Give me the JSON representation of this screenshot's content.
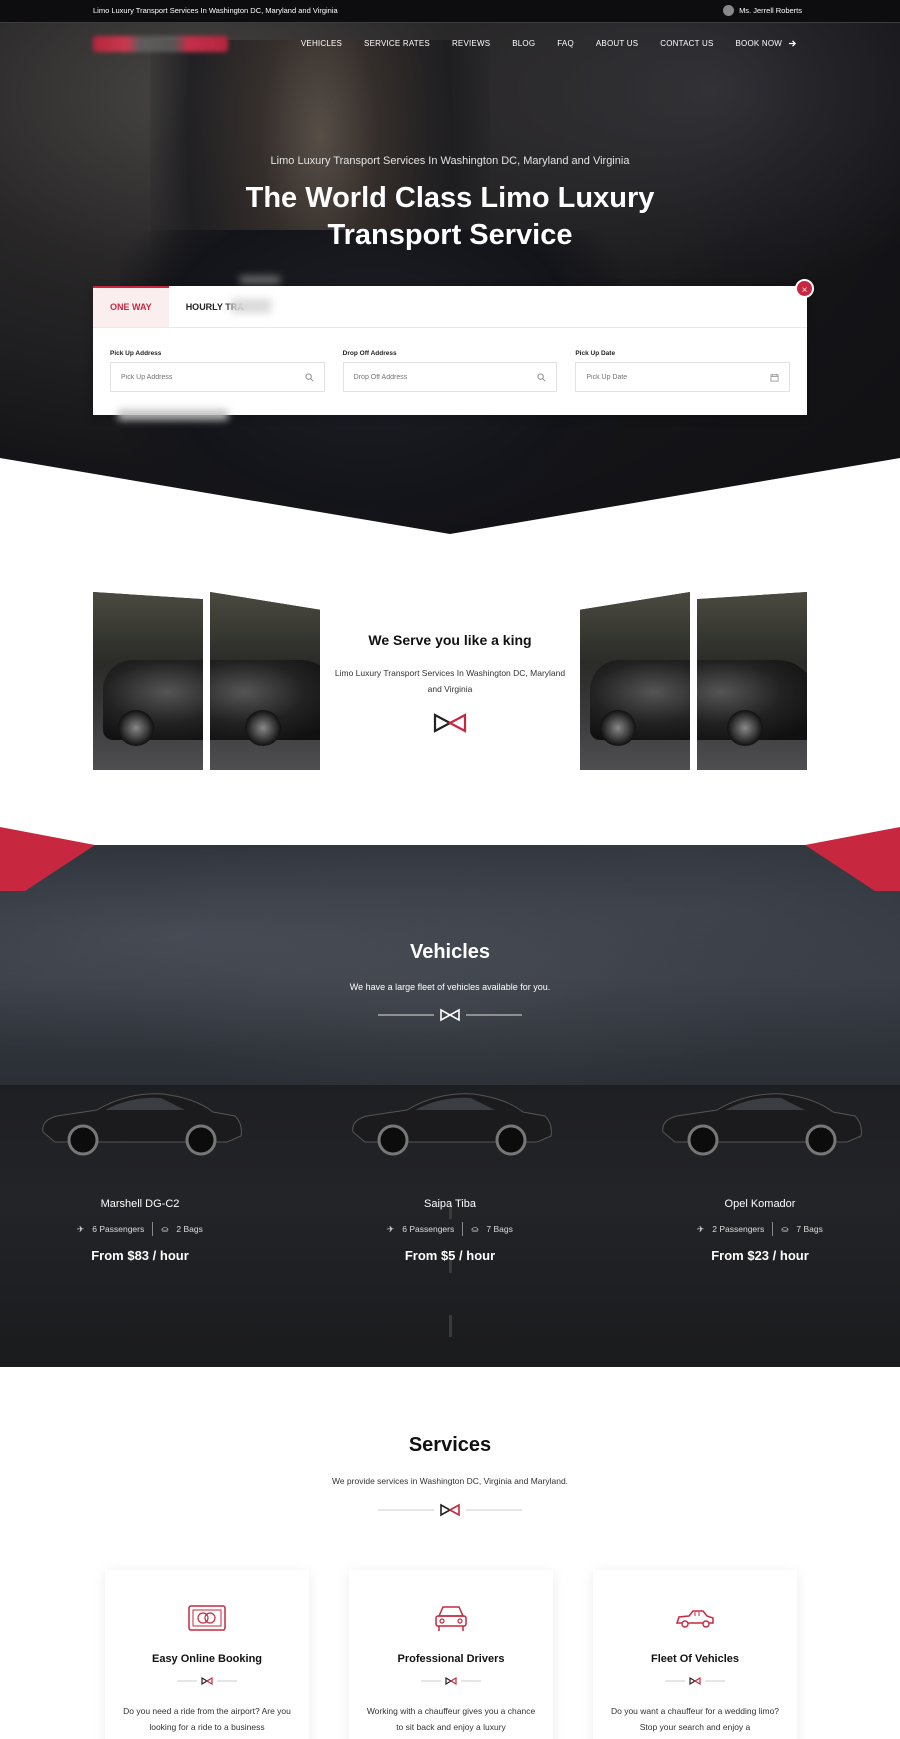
{
  "topbar": {
    "tagline": "Limo Luxury Transport Services In Washington DC, Maryland and Virginia",
    "user": "Ms. Jerrell Roberts"
  },
  "nav": {
    "items": [
      "VEHICLES",
      "SERVICE RATES",
      "REVIEWS",
      "BLOG",
      "FAQ",
      "ABOUT US",
      "CONTACT US"
    ],
    "book": "BOOK NOW"
  },
  "hero": {
    "subtitle": "Limo Luxury Transport Services In Washington DC, Maryland and Virginia",
    "title": "The World Class Limo Luxury Transport Service"
  },
  "booking": {
    "tabs": [
      "ONE WAY",
      "HOURLY TRA"
    ],
    "fields": [
      {
        "label": "Pick Up Address",
        "placeholder": "Pick Up Address",
        "icon": "search-icon"
      },
      {
        "label": "Drop Off Address",
        "placeholder": "Drop Off Address",
        "icon": "search-icon"
      },
      {
        "label": "Pick Up Date",
        "placeholder": "Pick Up Date",
        "icon": "calendar-icon"
      }
    ],
    "close": "×"
  },
  "king": {
    "title": "We Serve you like a king",
    "text": "Limo Luxury Transport Services In Washington DC, Maryland and Virginia"
  },
  "vehicles": {
    "title": "Vehicles",
    "subtitle": "We have a large fleet of vehicles available for you.",
    "items": [
      {
        "name": "Marshell DG-C2",
        "passengers": "6 Passengers",
        "bags": "2 Bags",
        "price": "From $83 / hour"
      },
      {
        "name": "Saipa Tiba",
        "passengers": "6 Passengers",
        "bags": "7 Bags",
        "price": "From $5 / hour"
      },
      {
        "name": "Opel Komador",
        "passengers": "2 Passengers",
        "bags": "7 Bags",
        "price": "From $23 / hour"
      }
    ]
  },
  "services": {
    "title": "Services",
    "subtitle": "We provide services in Washington DC, Virginia and Maryland.",
    "items": [
      {
        "title": "Easy Online Booking",
        "text": "Do you need a ride from the airport? Are you looking for a ride to a business",
        "icon": "credit-card-icon"
      },
      {
        "title": "Professional Drivers",
        "text": "Working with a chauffeur gives you a chance to sit back and enjoy a luxury",
        "icon": "car-front-icon"
      },
      {
        "title": "Fleet Of Vehicles",
        "text": "Do you want a chauffeur for a wedding limo? Stop your search and enjoy a",
        "icon": "limo-icon"
      }
    ]
  },
  "colors": {
    "accent": "#c7283f",
    "dark": "#151517"
  }
}
